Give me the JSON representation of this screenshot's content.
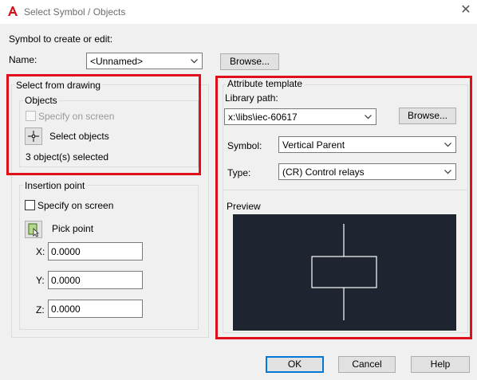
{
  "window": {
    "title": "Select Symbol / Objects",
    "app_icon": "autocad-a-icon",
    "close_icon": "close-icon"
  },
  "symbol_section": {
    "heading": "Symbol to create or edit:",
    "name_label": "Name:",
    "name_value": "<Unnamed>",
    "browse_label": "Browse..."
  },
  "select_from_drawing": {
    "title": "Select from drawing",
    "objects": {
      "title": "Objects",
      "specify_on_screen_label": "Specify on screen",
      "specify_on_screen_checked": false,
      "specify_on_screen_enabled": false,
      "select_objects_label": "Select objects",
      "selected_status": "3 object(s) selected"
    },
    "insertion_point": {
      "title": "Insertion point",
      "specify_on_screen_label": "Specify on screen",
      "specify_on_screen_checked": false,
      "pick_point_label": "Pick point",
      "x_label": "X:",
      "x_value": "0.0000",
      "y_label": "Y:",
      "y_value": "0.0000",
      "z_label": "Z:",
      "z_value": "0.0000"
    }
  },
  "attribute_template": {
    "title": "Attribute template",
    "library_path_label": "Library path:",
    "library_path_value": "x:\\libs\\iec-60617",
    "browse_label": "Browse...",
    "symbol_label": "Symbol:",
    "symbol_value": "Vertical Parent",
    "type_label": "Type:",
    "type_value": "(CR) Control relays",
    "preview_title": "Preview"
  },
  "buttons": {
    "ok": "OK",
    "cancel": "Cancel",
    "help": "Help"
  },
  "colors": {
    "highlight_red": "#e0101a",
    "preview_background": "#1f2530",
    "preview_stroke": "#ffffff",
    "default_button_border": "#0078d7",
    "dialog_background": "#f0f0f0"
  }
}
